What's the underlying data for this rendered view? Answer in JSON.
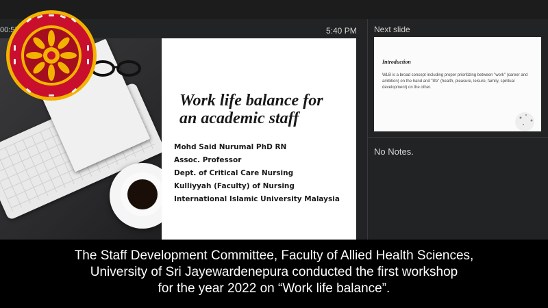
{
  "presenter": {
    "timer": "00:57",
    "clock": "5:40 PM",
    "next_slide_label": "Next slide",
    "notes_text": "No Notes."
  },
  "current_slide": {
    "title_line1": "Work life balance for",
    "title_line2": "an academic staff",
    "details": [
      "Mohd Said Nurumal PhD RN",
      "Assoc. Professor",
      "Dept. of Critical Care Nursing",
      "Kulliyyah (Faculty) of Nursing",
      "International Islamic University Malaysia"
    ]
  },
  "next_slide": {
    "title": "Introduction",
    "body": "WLB is a broad concept including proper prioritizing between \"work\" (career and ambition) on the hand and \"life\" (health, pleasure, leisure, family, spiritual development) on the other."
  },
  "caption": {
    "line1": "The Staff Development Committee, Faculty of Allied Health Sciences,",
    "line2": "University of Sri Jayewardenepura conducted the first workshop",
    "line3": "for the year 2022 on “Work life balance”."
  },
  "logo": {
    "name": "University of Sri Jayewardenepura emblem",
    "colors": {
      "outer": "#c8102e",
      "ring": "#f2b300",
      "inner": "#a50e1f"
    }
  }
}
